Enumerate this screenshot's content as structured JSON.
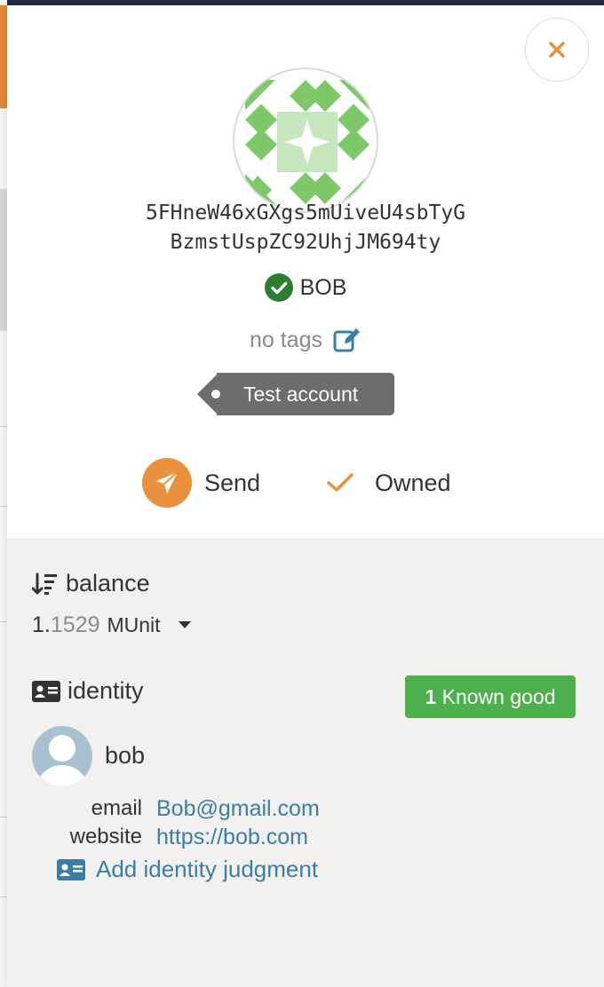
{
  "account": {
    "address_line1": "5FHneW46xGXgs5mUiveU4sbTyG",
    "address_line2": "BzmstUspZC92UhjJM694ty",
    "name": "BOB",
    "tags_text": "no tags",
    "badge_label": "Test account"
  },
  "actions": {
    "send_label": "Send",
    "owned_label": "Owned"
  },
  "balance": {
    "label": "balance",
    "integer_part": "1.",
    "fraction_part": "1529",
    "unit": "MUnit"
  },
  "identity": {
    "label": "identity",
    "judgement_count": "1",
    "judgement_label": "Known good",
    "display_name": "bob",
    "fields": [
      {
        "key": "email",
        "value": "Bob@gmail.com"
      },
      {
        "key": "website",
        "value": "https://bob.com"
      }
    ],
    "add_judgment_label": "Add identity judgment"
  },
  "colors": {
    "accent_orange": "#e8913e",
    "link_blue": "#3a7ea8",
    "success_green": "#4cb04c",
    "verified_green": "#2f7d32",
    "identicon_green": "#7ec86a"
  },
  "icons": {
    "close": "close-icon",
    "verified": "check-circle-icon",
    "edit": "edit-icon",
    "send": "paper-plane-icon",
    "owned": "checkmark-icon",
    "balance": "sort-amount-down-icon",
    "identity": "id-card-icon",
    "avatar": "user-avatar-icon"
  }
}
